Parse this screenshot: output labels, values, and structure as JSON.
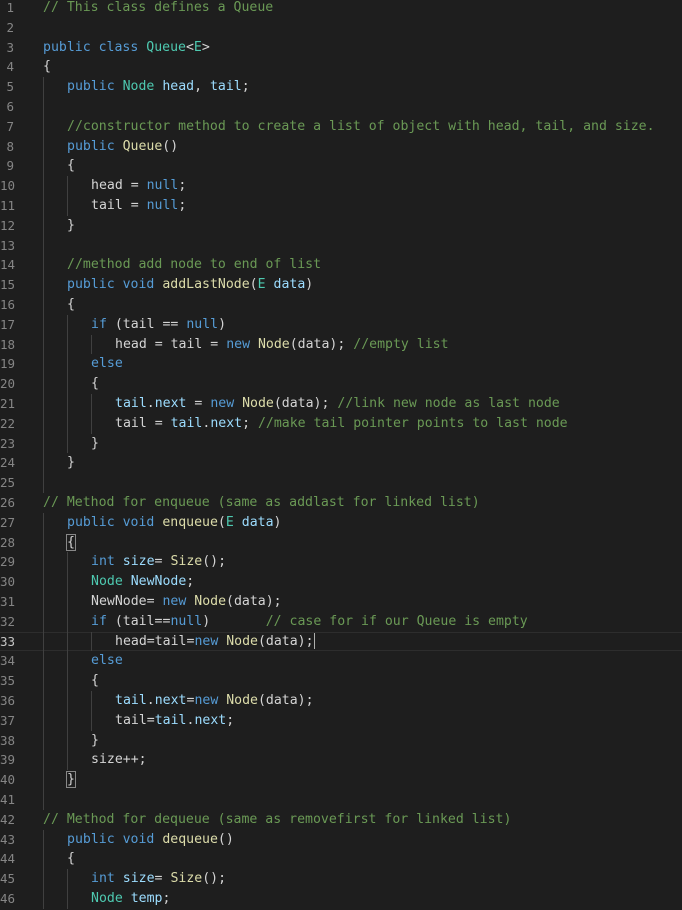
{
  "editor": {
    "language": "java",
    "active_line": 33,
    "theme": {
      "background": "#1e1e1e",
      "line_number": "#858585",
      "keyword": "#569cd6",
      "type": "#4ec9b0",
      "variable": "#9cdcfe",
      "function": "#dcdcaa",
      "comment": "#6a9955",
      "default": "#d4d4d4"
    },
    "lines": [
      {
        "n": "1",
        "indent": 0,
        "tokens": [
          {
            "t": "// This class defines a Queue",
            "c": "comment"
          }
        ]
      },
      {
        "n": "2",
        "indent": 0,
        "tokens": []
      },
      {
        "n": "3",
        "indent": 0,
        "tokens": [
          {
            "t": "public",
            "c": "keyword"
          },
          {
            "t": " ",
            "c": "plain"
          },
          {
            "t": "class",
            "c": "keyword"
          },
          {
            "t": " ",
            "c": "plain"
          },
          {
            "t": "Queue",
            "c": "type"
          },
          {
            "t": "<",
            "c": "plain"
          },
          {
            "t": "E",
            "c": "type"
          },
          {
            "t": ">",
            "c": "plain"
          }
        ]
      },
      {
        "n": "4",
        "indent": 0,
        "tokens": [
          {
            "t": "{",
            "c": "plain"
          }
        ]
      },
      {
        "n": "5",
        "indent": 1,
        "tokens": [
          {
            "t": "public",
            "c": "keyword"
          },
          {
            "t": " ",
            "c": "plain"
          },
          {
            "t": "Node",
            "c": "type"
          },
          {
            "t": " ",
            "c": "plain"
          },
          {
            "t": "head",
            "c": "var"
          },
          {
            "t": ", ",
            "c": "plain"
          },
          {
            "t": "tail",
            "c": "var"
          },
          {
            "t": ";",
            "c": "plain"
          }
        ]
      },
      {
        "n": "6",
        "indent": 1,
        "tokens": []
      },
      {
        "n": "7",
        "indent": 1,
        "tokens": [
          {
            "t": "//constructor method to create a list of object with head, tail, and size.",
            "c": "comment"
          }
        ]
      },
      {
        "n": "8",
        "indent": 1,
        "tokens": [
          {
            "t": "public",
            "c": "keyword"
          },
          {
            "t": " ",
            "c": "plain"
          },
          {
            "t": "Queue",
            "c": "func"
          },
          {
            "t": "()",
            "c": "plain"
          }
        ]
      },
      {
        "n": "9",
        "indent": 1,
        "tokens": [
          {
            "t": "{",
            "c": "plain"
          }
        ]
      },
      {
        "n": "10",
        "indent": 2,
        "tokens": [
          {
            "t": "head",
            "c": "plain"
          },
          {
            "t": " = ",
            "c": "plain"
          },
          {
            "t": "null",
            "c": "keyword"
          },
          {
            "t": ";",
            "c": "plain"
          }
        ]
      },
      {
        "n": "11",
        "indent": 2,
        "tokens": [
          {
            "t": "tail",
            "c": "plain"
          },
          {
            "t": " = ",
            "c": "plain"
          },
          {
            "t": "null",
            "c": "keyword"
          },
          {
            "t": ";",
            "c": "plain"
          }
        ]
      },
      {
        "n": "12",
        "indent": 1,
        "tokens": [
          {
            "t": "}",
            "c": "plain"
          }
        ]
      },
      {
        "n": "13",
        "indent": 1,
        "tokens": []
      },
      {
        "n": "14",
        "indent": 1,
        "tokens": [
          {
            "t": "//method add node to end of list",
            "c": "comment"
          }
        ]
      },
      {
        "n": "15",
        "indent": 1,
        "tokens": [
          {
            "t": "public",
            "c": "keyword"
          },
          {
            "t": " ",
            "c": "plain"
          },
          {
            "t": "void",
            "c": "keyword"
          },
          {
            "t": " ",
            "c": "plain"
          },
          {
            "t": "addLastNode",
            "c": "func"
          },
          {
            "t": "(",
            "c": "plain"
          },
          {
            "t": "E",
            "c": "type"
          },
          {
            "t": " ",
            "c": "plain"
          },
          {
            "t": "data",
            "c": "var"
          },
          {
            "t": ")",
            "c": "plain"
          }
        ]
      },
      {
        "n": "16",
        "indent": 1,
        "tokens": [
          {
            "t": "{",
            "c": "plain"
          }
        ]
      },
      {
        "n": "17",
        "indent": 2,
        "tokens": [
          {
            "t": "if",
            "c": "keyword"
          },
          {
            "t": " (",
            "c": "plain"
          },
          {
            "t": "tail",
            "c": "plain"
          },
          {
            "t": " == ",
            "c": "plain"
          },
          {
            "t": "null",
            "c": "keyword"
          },
          {
            "t": ")",
            "c": "plain"
          }
        ]
      },
      {
        "n": "18",
        "indent": 3,
        "tokens": [
          {
            "t": "head",
            "c": "plain"
          },
          {
            "t": " = ",
            "c": "plain"
          },
          {
            "t": "tail",
            "c": "plain"
          },
          {
            "t": " = ",
            "c": "plain"
          },
          {
            "t": "new",
            "c": "keyword"
          },
          {
            "t": " ",
            "c": "plain"
          },
          {
            "t": "Node",
            "c": "func"
          },
          {
            "t": "(data); ",
            "c": "plain"
          },
          {
            "t": "//empty list",
            "c": "comment"
          }
        ]
      },
      {
        "n": "19",
        "indent": 2,
        "tokens": [
          {
            "t": "else",
            "c": "keyword"
          }
        ]
      },
      {
        "n": "20",
        "indent": 2,
        "tokens": [
          {
            "t": "{",
            "c": "plain"
          }
        ]
      },
      {
        "n": "21",
        "indent": 3,
        "tokens": [
          {
            "t": "tail",
            "c": "var"
          },
          {
            "t": ".",
            "c": "plain"
          },
          {
            "t": "next",
            "c": "var"
          },
          {
            "t": " = ",
            "c": "plain"
          },
          {
            "t": "new",
            "c": "keyword"
          },
          {
            "t": " ",
            "c": "plain"
          },
          {
            "t": "Node",
            "c": "func"
          },
          {
            "t": "(data); ",
            "c": "plain"
          },
          {
            "t": "//link new node as last node",
            "c": "comment"
          }
        ]
      },
      {
        "n": "22",
        "indent": 3,
        "tokens": [
          {
            "t": "tail",
            "c": "plain"
          },
          {
            "t": " = ",
            "c": "plain"
          },
          {
            "t": "tail",
            "c": "var"
          },
          {
            "t": ".",
            "c": "plain"
          },
          {
            "t": "next",
            "c": "var"
          },
          {
            "t": "; ",
            "c": "plain"
          },
          {
            "t": "//make tail pointer points to last node",
            "c": "comment"
          }
        ]
      },
      {
        "n": "23",
        "indent": 2,
        "tokens": [
          {
            "t": "}",
            "c": "plain"
          }
        ]
      },
      {
        "n": "24",
        "indent": 1,
        "tokens": [
          {
            "t": "}",
            "c": "plain"
          }
        ]
      },
      {
        "n": "25",
        "indent": 1,
        "tokens": []
      },
      {
        "n": "26",
        "indent": 0,
        "tokens": [
          {
            "t": "// Method for enqueue (same as addlast for linked list)",
            "c": "comment"
          }
        ]
      },
      {
        "n": "27",
        "indent": 1,
        "tokens": [
          {
            "t": "public",
            "c": "keyword"
          },
          {
            "t": " ",
            "c": "plain"
          },
          {
            "t": "void",
            "c": "keyword"
          },
          {
            "t": " ",
            "c": "plain"
          },
          {
            "t": "enqueue",
            "c": "func"
          },
          {
            "t": "(",
            "c": "plain"
          },
          {
            "t": "E",
            "c": "type"
          },
          {
            "t": " ",
            "c": "plain"
          },
          {
            "t": "data",
            "c": "var"
          },
          {
            "t": ")",
            "c": "plain"
          }
        ]
      },
      {
        "n": "28",
        "indent": 1,
        "tokens": [
          {
            "t": "{",
            "c": "plain",
            "box": true
          }
        ]
      },
      {
        "n": "29",
        "indent": 2,
        "tokens": [
          {
            "t": "int",
            "c": "keyword"
          },
          {
            "t": " ",
            "c": "plain"
          },
          {
            "t": "size",
            "c": "var"
          },
          {
            "t": "= ",
            "c": "plain"
          },
          {
            "t": "Size",
            "c": "func"
          },
          {
            "t": "();",
            "c": "plain"
          }
        ]
      },
      {
        "n": "30",
        "indent": 2,
        "tokens": [
          {
            "t": "Node",
            "c": "type"
          },
          {
            "t": " ",
            "c": "plain"
          },
          {
            "t": "NewNode",
            "c": "var"
          },
          {
            "t": ";",
            "c": "plain"
          }
        ]
      },
      {
        "n": "31",
        "indent": 2,
        "tokens": [
          {
            "t": "NewNode",
            "c": "plain"
          },
          {
            "t": "= ",
            "c": "plain"
          },
          {
            "t": "new",
            "c": "keyword"
          },
          {
            "t": " ",
            "c": "plain"
          },
          {
            "t": "Node",
            "c": "func"
          },
          {
            "t": "(data);",
            "c": "plain"
          }
        ]
      },
      {
        "n": "32",
        "indent": 2,
        "tokens": [
          {
            "t": "if",
            "c": "keyword"
          },
          {
            "t": " (",
            "c": "plain"
          },
          {
            "t": "tail",
            "c": "plain"
          },
          {
            "t": "==",
            "c": "plain"
          },
          {
            "t": "null",
            "c": "keyword"
          },
          {
            "t": ")       ",
            "c": "plain"
          },
          {
            "t": "// case for if our Queue is empty",
            "c": "comment"
          }
        ]
      },
      {
        "n": "33",
        "indent": 3,
        "cursor": true,
        "tokens": [
          {
            "t": "head",
            "c": "plain"
          },
          {
            "t": "=",
            "c": "plain"
          },
          {
            "t": "tail",
            "c": "plain"
          },
          {
            "t": "=",
            "c": "plain"
          },
          {
            "t": "new",
            "c": "keyword"
          },
          {
            "t": " ",
            "c": "plain"
          },
          {
            "t": "Node",
            "c": "func"
          },
          {
            "t": "(data);",
            "c": "plain"
          }
        ]
      },
      {
        "n": "34",
        "indent": 2,
        "tokens": [
          {
            "t": "else",
            "c": "keyword"
          }
        ]
      },
      {
        "n": "35",
        "indent": 2,
        "tokens": [
          {
            "t": "{",
            "c": "plain"
          }
        ]
      },
      {
        "n": "36",
        "indent": 3,
        "tokens": [
          {
            "t": "tail",
            "c": "var"
          },
          {
            "t": ".",
            "c": "plain"
          },
          {
            "t": "next",
            "c": "var"
          },
          {
            "t": "=",
            "c": "plain"
          },
          {
            "t": "new",
            "c": "keyword"
          },
          {
            "t": " ",
            "c": "plain"
          },
          {
            "t": "Node",
            "c": "func"
          },
          {
            "t": "(data);",
            "c": "plain"
          }
        ]
      },
      {
        "n": "37",
        "indent": 3,
        "tokens": [
          {
            "t": "tail",
            "c": "plain"
          },
          {
            "t": "=",
            "c": "plain"
          },
          {
            "t": "tail",
            "c": "var"
          },
          {
            "t": ".",
            "c": "plain"
          },
          {
            "t": "next",
            "c": "var"
          },
          {
            "t": ";",
            "c": "plain"
          }
        ]
      },
      {
        "n": "38",
        "indent": 2,
        "tokens": [
          {
            "t": "}",
            "c": "plain"
          }
        ]
      },
      {
        "n": "39",
        "indent": 2,
        "tokens": [
          {
            "t": "size",
            "c": "plain"
          },
          {
            "t": "++;",
            "c": "plain"
          }
        ]
      },
      {
        "n": "40",
        "indent": 1,
        "tokens": [
          {
            "t": "}",
            "c": "plain",
            "box": true
          }
        ]
      },
      {
        "n": "41",
        "indent": 1,
        "tokens": []
      },
      {
        "n": "42",
        "indent": 0,
        "tokens": [
          {
            "t": "// Method for dequeue (same as removefirst for linked list)",
            "c": "comment"
          }
        ]
      },
      {
        "n": "43",
        "indent": 1,
        "tokens": [
          {
            "t": "public",
            "c": "keyword"
          },
          {
            "t": " ",
            "c": "plain"
          },
          {
            "t": "void",
            "c": "keyword"
          },
          {
            "t": " ",
            "c": "plain"
          },
          {
            "t": "dequeue",
            "c": "func"
          },
          {
            "t": "()",
            "c": "plain"
          }
        ]
      },
      {
        "n": "44",
        "indent": 1,
        "tokens": [
          {
            "t": "{",
            "c": "plain"
          }
        ]
      },
      {
        "n": "45",
        "indent": 2,
        "tokens": [
          {
            "t": "int",
            "c": "keyword"
          },
          {
            "t": " ",
            "c": "plain"
          },
          {
            "t": "size",
            "c": "var"
          },
          {
            "t": "= ",
            "c": "plain"
          },
          {
            "t": "Size",
            "c": "func"
          },
          {
            "t": "();",
            "c": "plain"
          }
        ]
      },
      {
        "n": "46",
        "indent": 2,
        "tokens": [
          {
            "t": "Node",
            "c": "type"
          },
          {
            "t": " ",
            "c": "plain"
          },
          {
            "t": "temp",
            "c": "var"
          },
          {
            "t": ";",
            "c": "plain"
          }
        ]
      }
    ]
  }
}
